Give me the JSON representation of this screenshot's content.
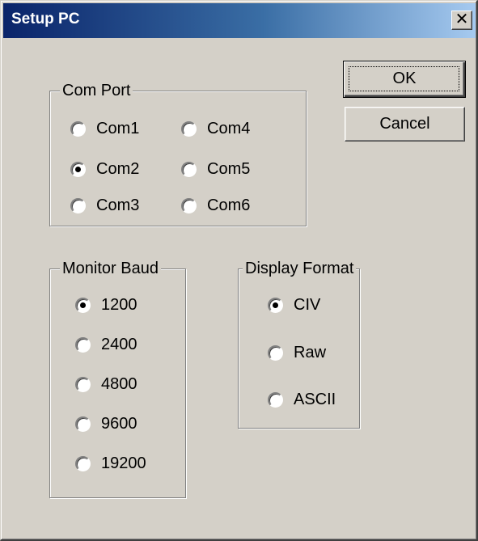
{
  "window": {
    "title": "Setup PC",
    "close_glyph": "✕"
  },
  "buttons": {
    "ok_label": "OK",
    "cancel_label": "Cancel"
  },
  "com_port": {
    "legend": "Com Port",
    "options": [
      "Com1",
      "Com4",
      "Com2",
      "Com5",
      "Com3",
      "Com6"
    ],
    "selected": "Com2"
  },
  "monitor_baud": {
    "legend": "Monitor Baud",
    "options": [
      "1200",
      "2400",
      "4800",
      "9600",
      "19200"
    ],
    "selected": "1200"
  },
  "display_format": {
    "legend": "Display Format",
    "options": [
      "CIV",
      "Raw",
      "ASCII"
    ],
    "selected": "CIV"
  },
  "colors": {
    "window_face": "#d4d0c8",
    "titlebar_start": "#0a246a",
    "titlebar_end": "#a6caf0"
  }
}
